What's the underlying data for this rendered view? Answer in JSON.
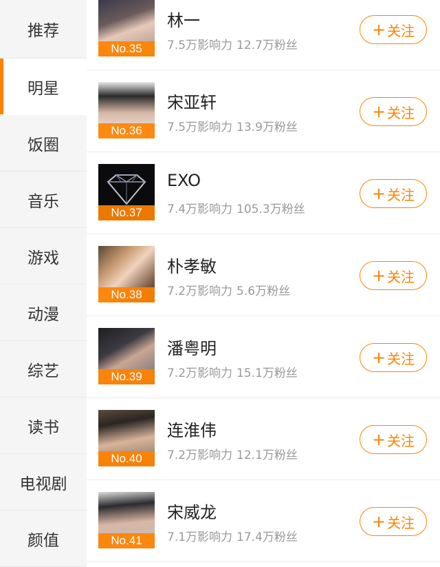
{
  "sidebar": {
    "items": [
      {
        "label": "推荐",
        "active": false
      },
      {
        "label": "明星",
        "active": true
      },
      {
        "label": "饭圈",
        "active": false
      },
      {
        "label": "音乐",
        "active": false
      },
      {
        "label": "游戏",
        "active": false
      },
      {
        "label": "动漫",
        "active": false
      },
      {
        "label": "综艺",
        "active": false
      },
      {
        "label": "读书",
        "active": false
      },
      {
        "label": "电视剧",
        "active": false
      },
      {
        "label": "颜值",
        "active": false
      }
    ]
  },
  "list": {
    "follow_plus": "+",
    "follow_label": "关注",
    "rows": [
      {
        "rank": "No.35",
        "name": "林一",
        "influence": "7.5万影响力",
        "fans": "12.7万粉丝"
      },
      {
        "rank": "No.36",
        "name": "宋亚轩",
        "influence": "7.5万影响力",
        "fans": "13.9万粉丝"
      },
      {
        "rank": "No.37",
        "name": "EXO",
        "influence": "7.4万影响力",
        "fans": "105.3万粉丝"
      },
      {
        "rank": "No.38",
        "name": "朴孝敏",
        "influence": "7.2万影响力",
        "fans": "5.6万粉丝"
      },
      {
        "rank": "No.39",
        "name": "潘粤明",
        "influence": "7.2万影响力",
        "fans": "15.1万粉丝"
      },
      {
        "rank": "No.40",
        "name": "连淮伟",
        "influence": "7.2万影响力",
        "fans": "12.1万粉丝"
      },
      {
        "rank": "No.41",
        "name": "宋威龙",
        "influence": "7.1万影响力",
        "fans": "17.4万粉丝"
      }
    ]
  },
  "colors": {
    "accent": "#ff8200",
    "sidebar_bg": "#f5f5f5",
    "muted_text": "#999999"
  }
}
